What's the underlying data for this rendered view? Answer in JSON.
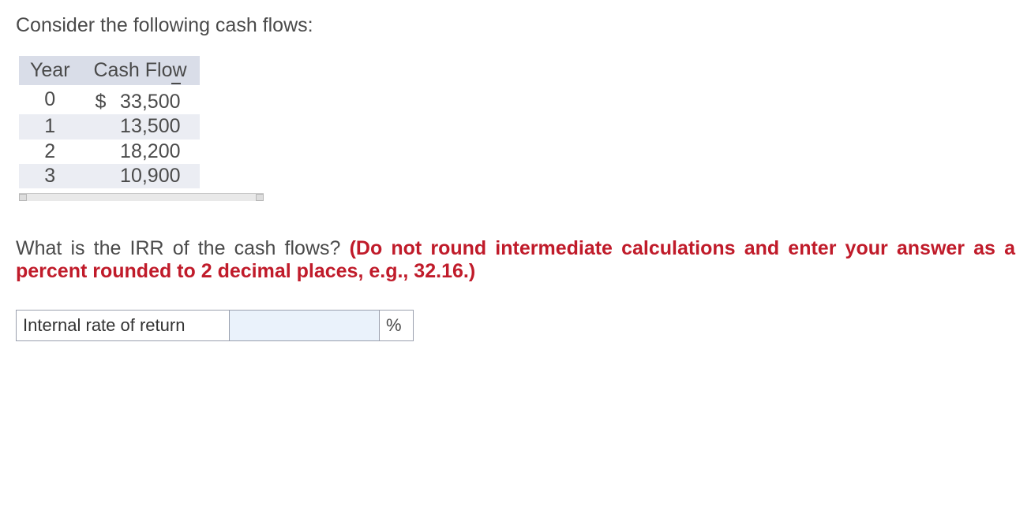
{
  "intro": "Consider the following cash flows:",
  "table": {
    "headers": {
      "year": "Year",
      "cash_flow": "Cash Flow"
    },
    "currency": "$",
    "rows": [
      {
        "year": "0",
        "amount": "33,500",
        "negative": true,
        "currency_prefix": true
      },
      {
        "year": "1",
        "amount": "13,500",
        "negative": false,
        "currency_prefix": false
      },
      {
        "year": "2",
        "amount": "18,200",
        "negative": false,
        "currency_prefix": false
      },
      {
        "year": "3",
        "amount": "10,900",
        "negative": false,
        "currency_prefix": false
      }
    ]
  },
  "question": {
    "black": "What is the IRR of the cash flows? ",
    "red": "(Do not round intermediate calculations and enter your answer as a percent rounded to 2 decimal places, e.g., 32.16.)"
  },
  "answer": {
    "label": "Internal rate of return",
    "value": "",
    "unit": "%"
  }
}
